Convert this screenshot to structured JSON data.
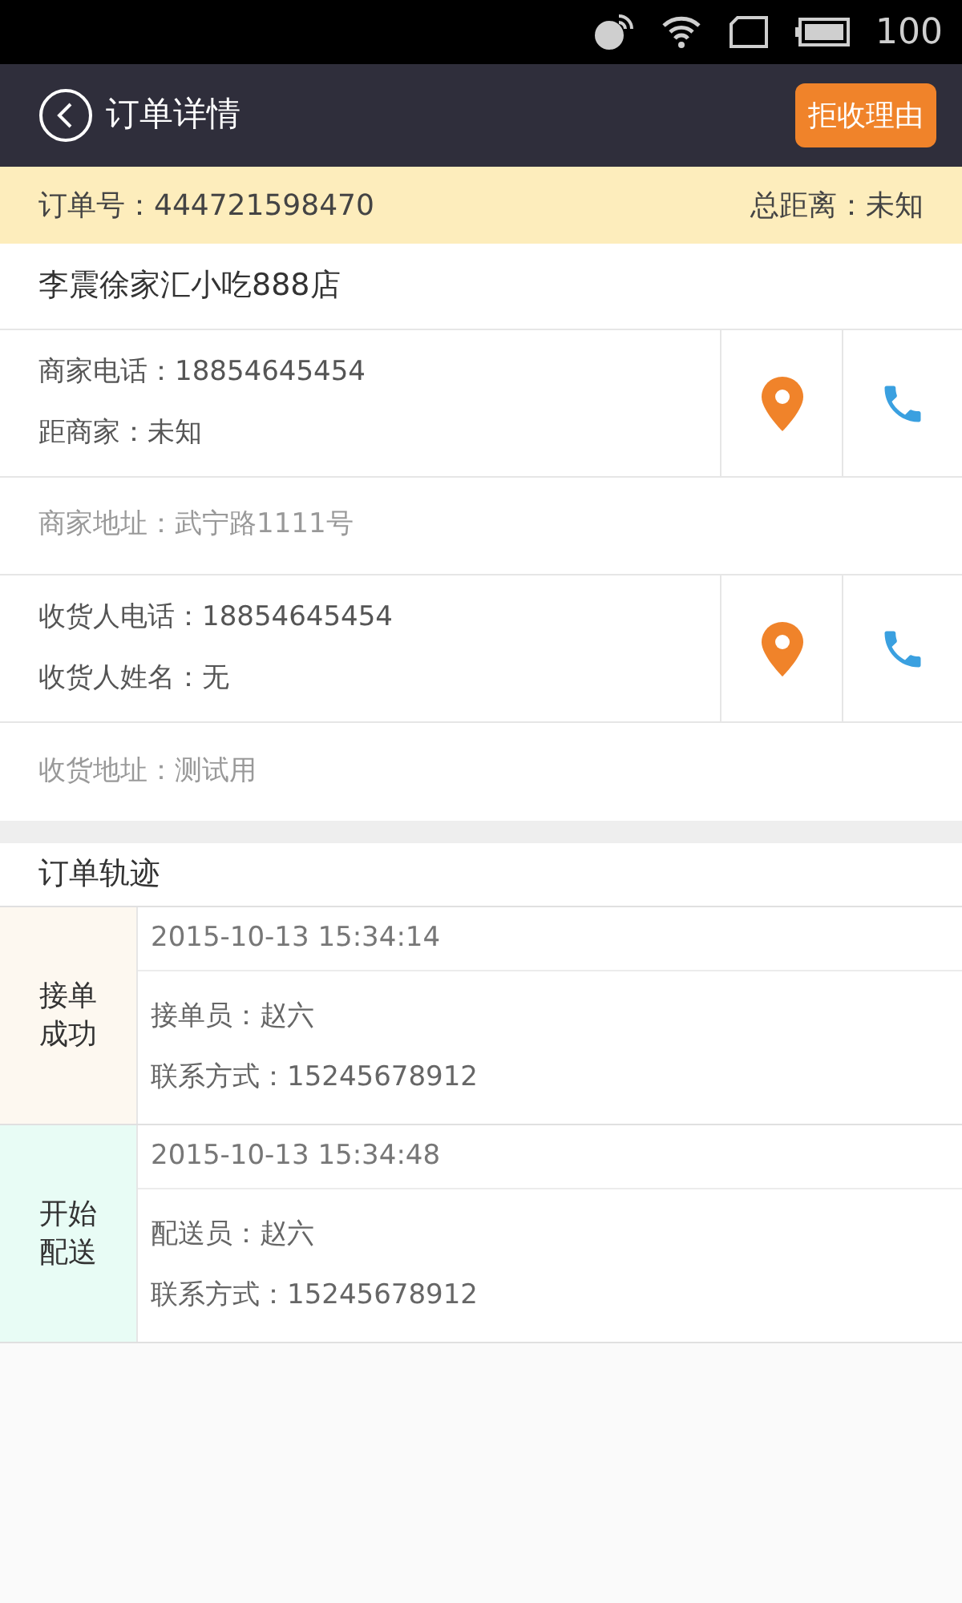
{
  "status_bar": {
    "battery": "100"
  },
  "header": {
    "title": "订单详情",
    "action": "拒收理由"
  },
  "order_bar": {
    "order_no": "订单号：444721598470",
    "distance": "总距离：未知"
  },
  "store_name": "李震徐家汇小吃888店",
  "contacts": [
    {
      "line_1": "商家电话：18854645454",
      "line_2": "距商家：未知",
      "address": "商家地址：武宁路1111号"
    },
    {
      "line_1": "收货人电话：18854645454",
      "line_2": "收货人姓名：无",
      "address": "收货地址：测试用"
    }
  ],
  "track": {
    "title": "订单轨迹",
    "stages": [
      {
        "label": "接单成功",
        "color": "#fdf8f0",
        "time": "2015-10-13 15:34:14",
        "lines": [
          "接单员：赵六",
          "联系方式：15245678912"
        ]
      },
      {
        "label": "开始配送",
        "color": "#e8fcf5",
        "time": "2015-10-13 15:34:48",
        "lines": [
          "配送员：赵六",
          "联系方式：15245678912"
        ]
      }
    ]
  }
}
